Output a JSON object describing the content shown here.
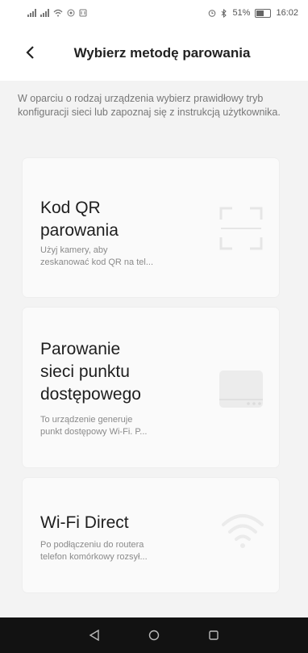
{
  "status_bar": {
    "time": "16:02",
    "battery": "51%"
  },
  "header": {
    "title": "Wybierz metodę parowania"
  },
  "description": "W oparciu o rodzaj urządzenia wybierz prawidłowy tryb konfiguracji sieci lub zapoznaj się z instrukcją użytkownika.",
  "options": [
    {
      "title_lines": [
        "Kod QR",
        "parowania"
      ],
      "subtitle_lines": [
        "Użyj kamery, aby",
        "zeskanować kod QR na tel..."
      ],
      "icon": "qr-scan-icon"
    },
    {
      "title_lines": [
        "Parowanie",
        "sieci punktu",
        "dostępowego"
      ],
      "subtitle_lines": [
        "To urządzenie generuje",
        "punkt dostępowy Wi-Fi. P..."
      ],
      "icon": "router-icon"
    },
    {
      "title_lines": [
        "Wi-Fi Direct"
      ],
      "subtitle_lines": [
        "Po podłączeniu do routera",
        "telefon komórkowy rozsył..."
      ],
      "icon": "wifi-icon"
    }
  ]
}
